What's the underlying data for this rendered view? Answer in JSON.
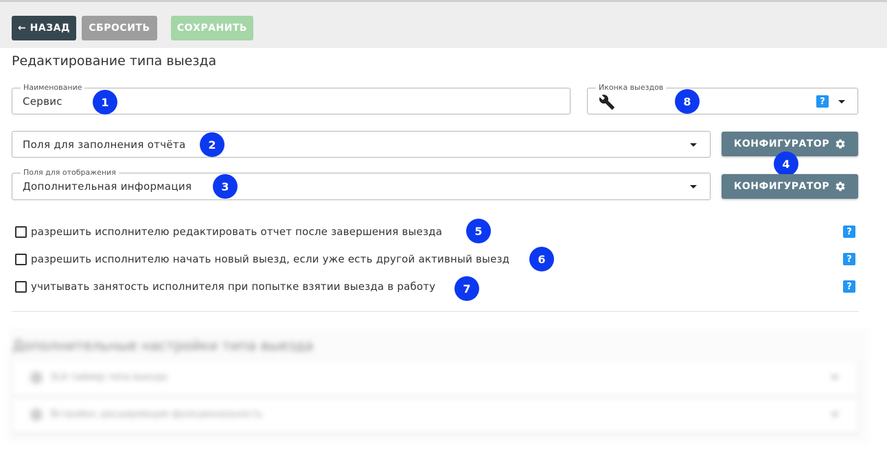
{
  "toolbar": {
    "back_label": "← НАЗАД",
    "reset_label": "СБРОСИТЬ",
    "save_label": "СОХРАНИТЬ"
  },
  "page_title": "Редактирование типа выезда",
  "form": {
    "name": {
      "label": "Наименование",
      "value": "Сервис"
    },
    "icon_field": {
      "label": "Иконка выездов",
      "icon": "wrench-icon"
    },
    "report_fields": {
      "value": "Поля для заполнения отчёта"
    },
    "display_fields": {
      "label": "Поля для отображения",
      "value": "Дополнительная информация"
    },
    "configurator_label": "КОНФИГУРАТОР",
    "help_glyph": "?"
  },
  "checkboxes": [
    {
      "label": "разрешить исполнителю редактировать отчет после завершения выезда",
      "checked": false
    },
    {
      "label": "разрешить исполнителю начать новый выезд, если уже есть другой активный выезд",
      "checked": false
    },
    {
      "label": "учитывать занятость исполнителя при попытке взятии выезда в работу",
      "checked": false
    }
  ],
  "badges": [
    "1",
    "2",
    "3",
    "4",
    "5",
    "6",
    "7",
    "8"
  ],
  "additional": {
    "title": "Дополнительные настройки типа выезда",
    "panels": [
      {
        "label": "SLA таймер типа выезда"
      },
      {
        "label": "Встройки, расширяющие функциональность"
      }
    ]
  },
  "colors": {
    "back": "#37474f",
    "reset": "#9e9e9e",
    "save": "#a5d6a7",
    "configurator": "#607d8b",
    "badge": "#0c39f0",
    "help": "#2196f3"
  }
}
